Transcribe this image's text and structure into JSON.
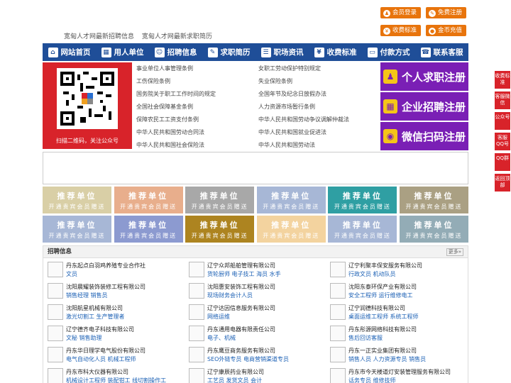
{
  "header": {
    "links": [
      "宽甸人才网最新招聘信息",
      "宽甸人才网最新求职简历"
    ],
    "buttons": [
      {
        "label": "会员登录",
        "icon": "user-icon"
      },
      {
        "label": "免费注册",
        "icon": "edit-icon"
      },
      {
        "label": "收费标准",
        "icon": "yen-icon"
      },
      {
        "label": "金币充值",
        "icon": "coin-icon"
      }
    ]
  },
  "nav": [
    {
      "label": "网站首页",
      "icon": "home-icon"
    },
    {
      "label": "用人单位",
      "icon": "building-icon"
    },
    {
      "label": "招聘信息",
      "icon": "people-icon"
    },
    {
      "label": "求职简历",
      "icon": "resume-icon"
    },
    {
      "label": "职场资讯",
      "icon": "news-icon"
    },
    {
      "label": "收费标准",
      "icon": "yen-icon"
    },
    {
      "label": "付款方式",
      "icon": "card-icon"
    },
    {
      "label": "联系客服",
      "icon": "phone-icon"
    }
  ],
  "qr": {
    "caption": "扫描二维码，关注公众号"
  },
  "law_links": [
    [
      "事业单位人事管理条例",
      "女职工劳动保护特别规定"
    ],
    [
      "工伤保险条例",
      "失业保险条例"
    ],
    [
      "国务院关于职工工作时间的规定",
      "全国年节及纪念日放假办法"
    ],
    [
      "全国社会保障基金条例",
      "人力资源市场暂行条例"
    ],
    [
      "保障农民工工资支付条例",
      "中华人民共和国劳动争议调解仲裁法"
    ],
    [
      "中华人民共和国劳动合同法",
      "中华人民共和国就业促进法"
    ],
    [
      "中华人民共和国社会保险法",
      "中华人民共和国劳动法"
    ]
  ],
  "register": [
    {
      "label": "个人求职注册",
      "icon": "person-icon"
    },
    {
      "label": "企业招聘注册",
      "icon": "company-icon"
    },
    {
      "label": "微信扫码注册",
      "icon": "wechat-icon"
    }
  ],
  "recommend": {
    "title": "推荐单位",
    "sub": "开通贵宾会员赠送",
    "colors": [
      "#d9cfa6",
      "#e8ae8c",
      "#a8a8a8",
      "#a7b7d6",
      "#2f9fa3",
      "#aaa083",
      "#a7b7d6",
      "#8c9ad0",
      "#ad8420",
      "#f3d39f",
      "#a7b7d6",
      "#93acb6"
    ]
  },
  "recruit": {
    "title": "招聘信息",
    "more": "更多»",
    "jobs": [
      [
        "丹东起点白羽鸡养殖专业合作社",
        "文员"
      ],
      [
        "辽宁众邦船舶管理有限公司",
        "货轮厨师 电子技工 海员 水手"
      ],
      [
        "辽宁利聚丰保安服务有限公司",
        "行政文员 机动队员"
      ],
      [
        "沈阳晨耀装饰装修工程有限公司",
        "销售经理 销售员"
      ],
      [
        "沈阳惠安装饰工程有限公司",
        "现场财务会计人员"
      ],
      [
        "沈阳东泰环保产业有限公司",
        "安全工程师 运行维修电工"
      ],
      [
        "沈阳航星机械有限公司",
        "激光切割工 生产管理者"
      ],
      [
        "辽宁达因信息服务有限公司",
        "网络运维"
      ],
      [
        "辽宁润德科技有限公司",
        "桌面运维工程师 系统工程师"
      ],
      [
        "辽宁德齐电子科技有限公司",
        "文秘 销售助理"
      ],
      [
        "丹东通用电器有限责任公司",
        "电子、机械"
      ],
      [
        "丹东彤源网络科技有限公司",
        "售后回访客服"
      ],
      [
        "丹东华日理学电气股份有限公司",
        "电气自动化人员 机械工程师"
      ],
      [
        "丹东鹰豆商务服务有限公司",
        "SEO外链专员 电商营销渠道专员"
      ],
      [
        "丹东一正实业集团有限公司",
        "销售人员 人力资源专员 销售员"
      ],
      [
        "丹东市科大仪器有限公司",
        "机械设计工程师 装配钳工 线切割操作工"
      ],
      [
        "辽宁康辰药业有限公司",
        "工艺员 发货文员 会计"
      ],
      [
        "丹东市今天楼道灯安装管理服务有限公司",
        "话务专员 维修技师"
      ]
    ]
  },
  "side": [
    {
      "label": "收费标准"
    },
    {
      "label": "客服微信"
    },
    {
      "label": "公众号"
    },
    {
      "label": "客服QQ号"
    },
    {
      "label": "QQ群"
    },
    {
      "label": "返回顶部"
    }
  ]
}
